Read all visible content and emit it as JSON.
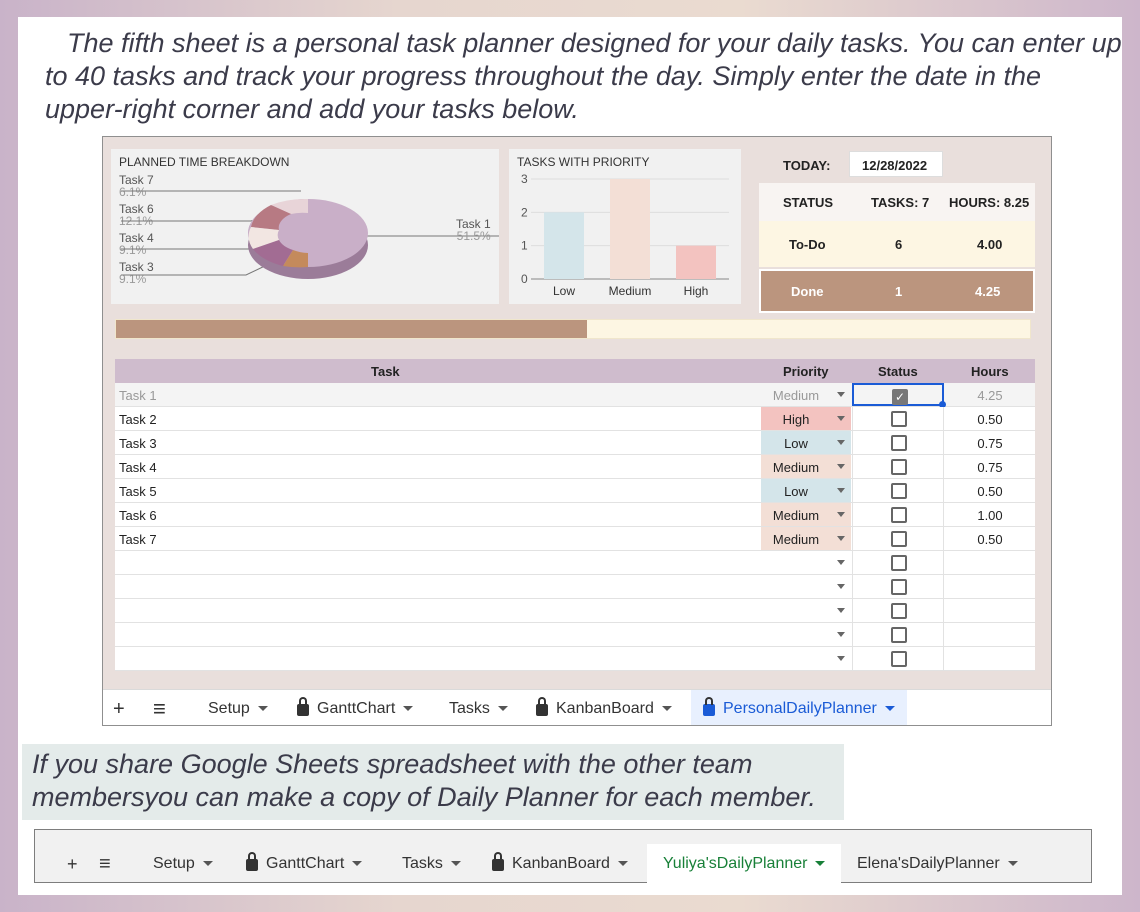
{
  "intro_text": "The fifth sheet is a personal task planner designed for your daily tasks. You can enter up to 40 tasks and track your progress throughout the day. Simply enter the date in the upper-right corner and add your tasks below.",
  "note_text": "If you share Google Sheets spreadsheet with the other team membersyou can make a copy of Daily Planner for each member.",
  "colors": {
    "mauve": "#c9afc8",
    "tan": "#bb957e",
    "cream": "#fdf6e3",
    "pink": "#f3c3c0",
    "lightblue": "#d4e5ea",
    "peach": "#f3dfd6",
    "link_blue": "#1a5bd6",
    "green_active": "#188038"
  },
  "donut_chart": {
    "title": "PLANNED TIME BREAKDOWN",
    "legend": [
      {
        "label": "Task 7",
        "pct": "6.1%"
      },
      {
        "label": "Task 6",
        "pct": "12.1%"
      },
      {
        "label": "Task 4",
        "pct": "9.1%"
      },
      {
        "label": "Task 3",
        "pct": "9.1%"
      }
    ],
    "callout": {
      "label": "Task 1",
      "pct": "51.5%"
    }
  },
  "chart_data": {
    "type": "bar",
    "title": "TASKS WITH PRIORITY",
    "categories": [
      "Low",
      "Medium",
      "High"
    ],
    "values": [
      2,
      3,
      1
    ],
    "colors": [
      "#d4e5ea",
      "#f3dfd6",
      "#f3c3c0"
    ],
    "yticks": [
      "0",
      "1",
      "2",
      "3"
    ],
    "ylim": [
      0,
      3
    ]
  },
  "summary": {
    "today_label": "TODAY:",
    "date": "12/28/2022",
    "status_label": "STATUS",
    "tasks_label": "TASKS: 7",
    "hours_label": "HOURS: 8.25",
    "rows": [
      {
        "status": "To-Do",
        "tasks": "6",
        "hours": "4.00"
      },
      {
        "status": "Done",
        "tasks": "1",
        "hours": "4.25"
      }
    ]
  },
  "progress_fraction": 0.515,
  "table": {
    "headers": {
      "task": "Task",
      "priority": "Priority",
      "status": "Status",
      "hours": "Hours"
    },
    "rows": [
      {
        "task": "Task 1",
        "priority": "Medium",
        "done": true,
        "hours": "4.25"
      },
      {
        "task": "Task 2",
        "priority": "High",
        "done": false,
        "hours": "0.50"
      },
      {
        "task": "Task 3",
        "priority": "Low",
        "done": false,
        "hours": "0.75"
      },
      {
        "task": "Task 4",
        "priority": "Medium",
        "done": false,
        "hours": "0.75"
      },
      {
        "task": "Task 5",
        "priority": "Low",
        "done": false,
        "hours": "0.50"
      },
      {
        "task": "Task 6",
        "priority": "Medium",
        "done": false,
        "hours": "1.00"
      },
      {
        "task": "Task 7",
        "priority": "Medium",
        "done": false,
        "hours": "0.50"
      },
      {
        "task": "",
        "priority": "",
        "done": false,
        "hours": ""
      },
      {
        "task": "",
        "priority": "",
        "done": false,
        "hours": ""
      },
      {
        "task": "",
        "priority": "",
        "done": false,
        "hours": ""
      },
      {
        "task": "",
        "priority": "",
        "done": false,
        "hours": ""
      },
      {
        "task": "",
        "priority": "",
        "done": false,
        "hours": ""
      }
    ]
  },
  "tabs_main": [
    "Setup",
    "GanttChart",
    "Tasks",
    "KanbanBoard",
    "PersonalDailyPlanner"
  ],
  "tabs_second": [
    "Setup",
    "GanttChart",
    "Tasks",
    "KanbanBoard",
    "Yuliya'sDailyPlanner",
    "Elena'sDailyPlanner"
  ],
  "icons": {
    "add": "+",
    "menu": "≡"
  }
}
